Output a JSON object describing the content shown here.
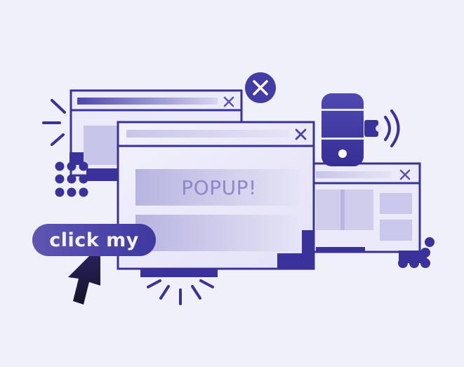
{
  "popup": {
    "message": "POPUP!"
  },
  "cta": {
    "label": "click my"
  },
  "colors": {
    "background": "#f0f0fb",
    "outline": "#3a329a",
    "accent": "#4b43ad",
    "pill": "#4b43ad",
    "cursor": "#1f1b3f"
  },
  "icons": [
    "close-icon",
    "phone-icon",
    "speaker-icon",
    "cursor-icon",
    "burst-lines-icon",
    "dot-grid-icon"
  ]
}
